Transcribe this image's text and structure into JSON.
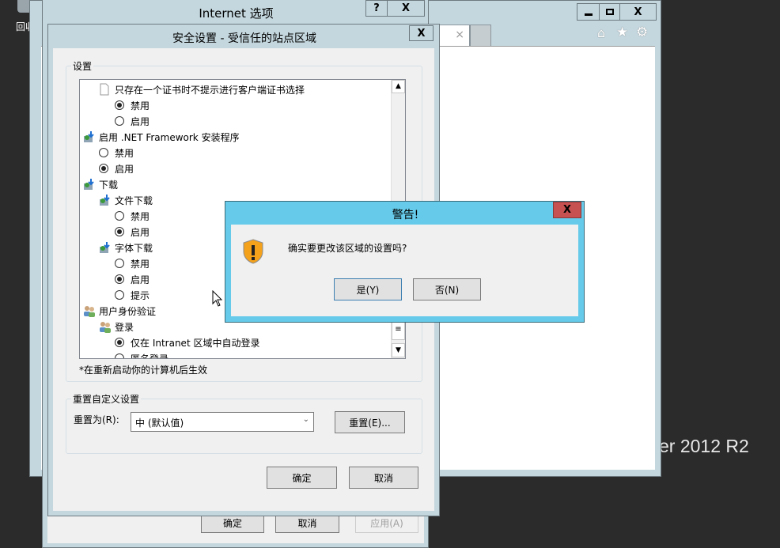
{
  "desktop": {
    "recycle_label": "回收站",
    "os_watermark": "er 2012 R2"
  },
  "ie": {
    "controls": {
      "minimize": "▁",
      "maximize": "□",
      "close": "X"
    },
    "tab_close": "×"
  },
  "internet_options": {
    "title": "Internet 选项",
    "help": "?",
    "close": "X",
    "ok": "确定",
    "cancel": "取消",
    "apply": "应用(A)"
  },
  "security": {
    "title": "安全设置 - 受信任的站点区域",
    "close": "X",
    "settings_group": "设置",
    "items": [
      {
        "type": "doc",
        "indent": 1,
        "label": "只存在一个证书时不提示进行客户端证书选择"
      },
      {
        "type": "radio",
        "indent": 2,
        "label": "禁用",
        "checked": true
      },
      {
        "type": "radio",
        "indent": 2,
        "label": "启用",
        "checked": false
      },
      {
        "type": "setting",
        "indent": 0,
        "label": "启用 .NET Framework 安装程序"
      },
      {
        "type": "radio",
        "indent": 1,
        "label": "禁用",
        "checked": false
      },
      {
        "type": "radio",
        "indent": 1,
        "label": "启用",
        "checked": true
      },
      {
        "type": "setting",
        "indent": 0,
        "label": "下载"
      },
      {
        "type": "setting",
        "indent": 1,
        "label": "文件下载"
      },
      {
        "type": "radio",
        "indent": 2,
        "label": "禁用",
        "checked": false
      },
      {
        "type": "radio",
        "indent": 2,
        "label": "启用",
        "checked": true
      },
      {
        "type": "setting",
        "indent": 1,
        "label": "字体下载"
      },
      {
        "type": "radio",
        "indent": 2,
        "label": "禁用",
        "checked": false
      },
      {
        "type": "radio",
        "indent": 2,
        "label": "启用",
        "checked": true
      },
      {
        "type": "radio",
        "indent": 2,
        "label": "提示",
        "checked": false
      },
      {
        "type": "user",
        "indent": 0,
        "label": "用户身份验证"
      },
      {
        "type": "user",
        "indent": 1,
        "label": "登录"
      },
      {
        "type": "radio",
        "indent": 2,
        "label": "仅在 Intranet 区域中自动登录",
        "checked": true
      },
      {
        "type": "radio",
        "indent": 2,
        "label": "匿名登录",
        "checked": false
      }
    ],
    "note": "*在重新启动你的计算机后生效",
    "reset_group": "重置自定义设置",
    "reset_to_label": "重置为(R):",
    "reset_to_value": "中 (默认值)",
    "reset_button": "重置(E)...",
    "ok": "确定",
    "cancel": "取消"
  },
  "warning": {
    "title": "警告!",
    "close": "X",
    "message": "确实要更改该区域的设置吗?",
    "yes": "是(Y)",
    "no": "否(N)"
  },
  "colors": {
    "window_frame": "#c4d7de",
    "warning_frame": "#66cbea",
    "close_red": "#c75050"
  }
}
